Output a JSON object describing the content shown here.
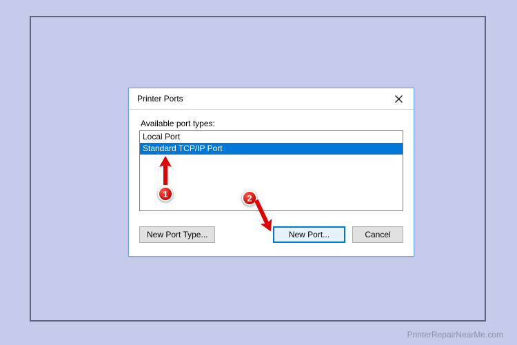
{
  "dialog": {
    "title": "Printer Ports",
    "available_label": "Available port types:",
    "ports": [
      {
        "name": "Local Port",
        "selected": false
      },
      {
        "name": "Standard TCP/IP Port",
        "selected": true
      }
    ],
    "buttons": {
      "new_port_type": "New Port Type...",
      "new_port": "New Port...",
      "cancel": "Cancel"
    }
  },
  "annotations": {
    "badge1": "1",
    "badge2": "2"
  },
  "watermark": "PrinterRepairNearMe.com"
}
